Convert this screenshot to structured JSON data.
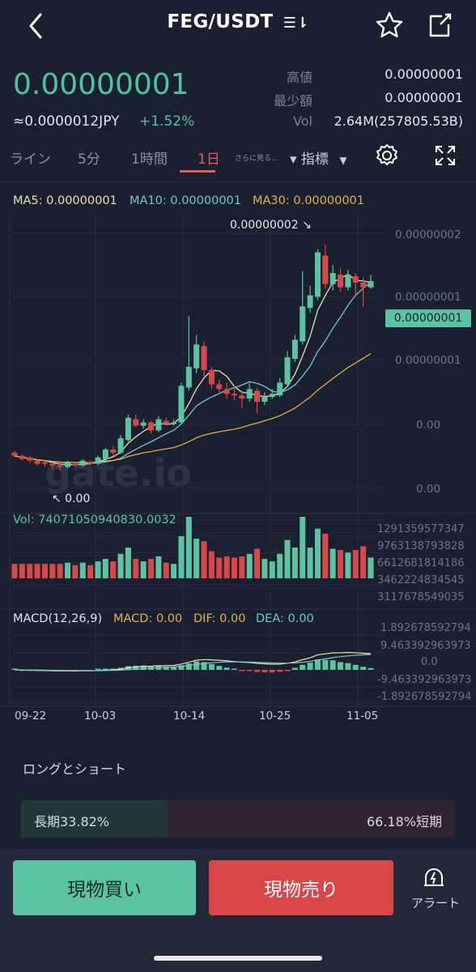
{
  "header": {
    "title": "FEG/USDT",
    "sort_glyph": "☰⇂"
  },
  "price": {
    "last": "0.00000001",
    "jpy": "≈0.0000012JPY",
    "change": "+1.52%"
  },
  "stats": {
    "high_label": "高値",
    "high_value": "0.00000001",
    "low_label": "最少額",
    "low_value": "0.00000001",
    "vol_label": "Vol",
    "vol_value": "2.64M(257805.53B)"
  },
  "tabs": [
    {
      "label": "ライン"
    },
    {
      "label": "5分"
    },
    {
      "label": "1時間"
    },
    {
      "label": "1日"
    }
  ],
  "more_label": "さらに見る...",
  "indicator_label": "▾ 指標",
  "ma": {
    "ma5": "MA5: 0.00000001",
    "ma10": "MA10: 0.00000001",
    "ma30": "MA30: 0.00000001"
  },
  "price_axis": [
    "0.00000002",
    "0.00000001",
    "0.00000001",
    "0.00",
    "0.00"
  ],
  "high_marker": "0.00000002 ↘",
  "low_marker": "↖ 0.00",
  "last_price_tag": "0.00000001",
  "watermark": "gate.io",
  "vol_label": "Vol: 74071050940830.0032",
  "vol_axis": [
    "1291359577347",
    "9763138793828",
    "6612681814186",
    "3462224834545",
    "3117678549035"
  ],
  "macd_labels": {
    "title": "MACD(12,26,9)",
    "macd": "MACD: 0.00",
    "dif": "DIF: 0.00",
    "dea": "DEA: 0.00"
  },
  "macd_axis": [
    "1.892678592794",
    "9.463392963973",
    "0.0",
    "-9.463392963973",
    "-1.892678592794"
  ],
  "date_axis": [
    "09-22",
    "10-03",
    "10-14",
    "10-25",
    "11-05"
  ],
  "long_short": {
    "title": "ロングとショート",
    "long": "長期33.82%",
    "short": "66.18%短期",
    "long_pct": 33.82
  },
  "buttons": {
    "buy": "現物買い",
    "sell": "現物売り",
    "alert": "アラート"
  },
  "colors": {
    "up": "#5bc3a2",
    "down": "#d94748",
    "ma5": "#e8e0b0",
    "ma10": "#76c7c0",
    "ma30": "#e0b048",
    "accent": "#e55a5a"
  },
  "chart_data": {
    "type": "candlestick",
    "x_ticks": [
      "09-22",
      "10-03",
      "10-14",
      "10-25",
      "11-05"
    ],
    "y_axis_ticks": [
      "0.00000002",
      "0.00000001",
      "0.00000001",
      "0.00",
      "0.00"
    ],
    "candles": [
      [
        2.2,
        2.0,
        2.3,
        1.9
      ],
      [
        2.0,
        1.8,
        2.1,
        1.7
      ],
      [
        1.9,
        1.7,
        2.0,
        1.6
      ],
      [
        1.7,
        1.5,
        1.8,
        1.4
      ],
      [
        1.6,
        1.5,
        1.7,
        1.3
      ],
      [
        1.5,
        1.4,
        1.6,
        1.2
      ],
      [
        1.4,
        1.3,
        1.5,
        1.1
      ],
      [
        1.3,
        1.6,
        1.7,
        1.2
      ],
      [
        1.5,
        1.4,
        1.6,
        1.3
      ],
      [
        1.4,
        1.7,
        1.8,
        1.3
      ],
      [
        1.6,
        1.5,
        1.7,
        1.4
      ],
      [
        1.5,
        1.9,
        2.0,
        1.4
      ],
      [
        1.8,
        2.4,
        2.5,
        1.7
      ],
      [
        2.4,
        2.2,
        2.6,
        2.0
      ],
      [
        2.2,
        3.1,
        3.3,
        2.1
      ],
      [
        3.0,
        4.4,
        4.6,
        2.9
      ],
      [
        4.3,
        3.9,
        4.6,
        3.8
      ],
      [
        3.9,
        4.1,
        4.3,
        3.7
      ],
      [
        4.1,
        3.6,
        4.2,
        3.4
      ],
      [
        3.6,
        4.3,
        4.5,
        3.5
      ],
      [
        4.2,
        4.0,
        4.4,
        3.9
      ],
      [
        4.0,
        4.1,
        4.3,
        3.9
      ],
      [
        4.1,
        6.4,
        6.6,
        4.0
      ],
      [
        6.3,
        7.6,
        10.8,
        6.1
      ],
      [
        7.5,
        9.0,
        9.6,
        7.2
      ],
      [
        8.9,
        7.4,
        9.2,
        7.0
      ],
      [
        7.4,
        6.5,
        7.6,
        6.2
      ],
      [
        6.5,
        6.2,
        6.8,
        5.9
      ],
      [
        6.2,
        5.9,
        6.6,
        5.6
      ],
      [
        5.9,
        5.8,
        6.4,
        5.5
      ],
      [
        5.8,
        5.6,
        6.0,
        5.0
      ],
      [
        5.6,
        6.2,
        6.6,
        5.4
      ],
      [
        6.1,
        5.4,
        6.3,
        4.7
      ],
      [
        5.4,
        5.7,
        6.0,
        5.2
      ],
      [
        5.7,
        5.9,
        6.2,
        5.6
      ],
      [
        5.8,
        6.6,
        6.9,
        5.7
      ],
      [
        6.5,
        8.2,
        8.6,
        6.3
      ],
      [
        8.1,
        9.3,
        9.6,
        7.9
      ],
      [
        9.2,
        11.4,
        13.6,
        9.0
      ],
      [
        11.3,
        12.1,
        12.7,
        11.0
      ],
      [
        12.0,
        14.8,
        15.0,
        11.8
      ],
      [
        14.6,
        12.8,
        15.3,
        12.5
      ],
      [
        12.8,
        13.5,
        14.0,
        12.4
      ],
      [
        13.4,
        12.6,
        13.8,
        12.3
      ],
      [
        12.6,
        13.4,
        13.7,
        12.4
      ],
      [
        13.3,
        12.9,
        13.5,
        12.0
      ],
      [
        12.9,
        12.6,
        13.2,
        11.4
      ],
      [
        12.6,
        13.0,
        13.4,
        12.5
      ]
    ]
  }
}
